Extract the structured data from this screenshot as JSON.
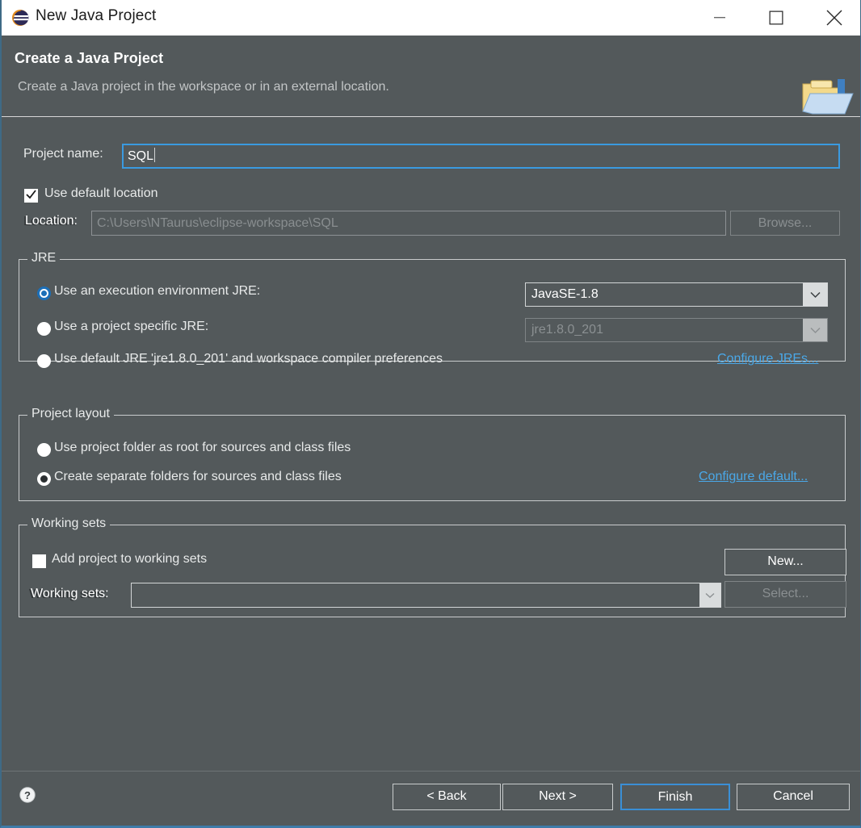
{
  "window": {
    "title": "New Java Project",
    "icon": "eclipse-logo-icon",
    "minimize_label": "minimize-icon",
    "maximize_label": "maximize-icon",
    "close_label": "close-icon"
  },
  "header": {
    "title": "Create a Java Project",
    "description": "Create a Java project in the workspace or in an external location.",
    "icon": "new-java-project-folder-icon"
  },
  "form": {
    "project_name_label": "Project name:",
    "project_name_value": "SQL",
    "use_default_location_label": "Use default location",
    "use_default_location_checked": true,
    "location_label": "Location:",
    "location_value": "C:\\Users\\NTaurus\\eclipse-workspace\\SQL",
    "browse_label": "Browse..."
  },
  "jre": {
    "group_label": "JRE",
    "option_execution_env": "Use an execution environment JRE:",
    "option_project_specific": "Use a project specific JRE:",
    "option_default_jre": "Use default JRE 'jre1.8.0_201' and workspace compiler preferences",
    "selected": "execution_env",
    "execution_env_value": "JavaSE-1.8",
    "project_specific_value": "jre1.8.0_201",
    "configure_link": "Configure JREs..."
  },
  "project_layout": {
    "group_label": "Project layout",
    "option_project_folder_root": "Use project folder as root for sources and class files",
    "option_separate_folders": "Create separate folders for sources and class files",
    "selected": "separate_folders",
    "configure_link": "Configure default..."
  },
  "working_sets": {
    "group_label": "Working sets",
    "add_project_label": "Add project to working sets",
    "add_project_checked": false,
    "working_sets_label": "Working sets:",
    "working_sets_value": "",
    "new_label": "New...",
    "select_label": "Select..."
  },
  "footer": {
    "help_label": "help-icon",
    "back_label": "< Back",
    "next_label": "Next >",
    "finish_label": "Finish",
    "cancel_label": "Cancel"
  },
  "colors": {
    "dialog_bg": "#53595b",
    "titlebar_bg": "#ffffff",
    "accent_blue": "#3a8fd6",
    "link_blue": "#4aa8e8",
    "radio_selected_blue": "#1c6fb8",
    "border_light": "#c9cccd",
    "disabled_text": "#8a8f91"
  }
}
